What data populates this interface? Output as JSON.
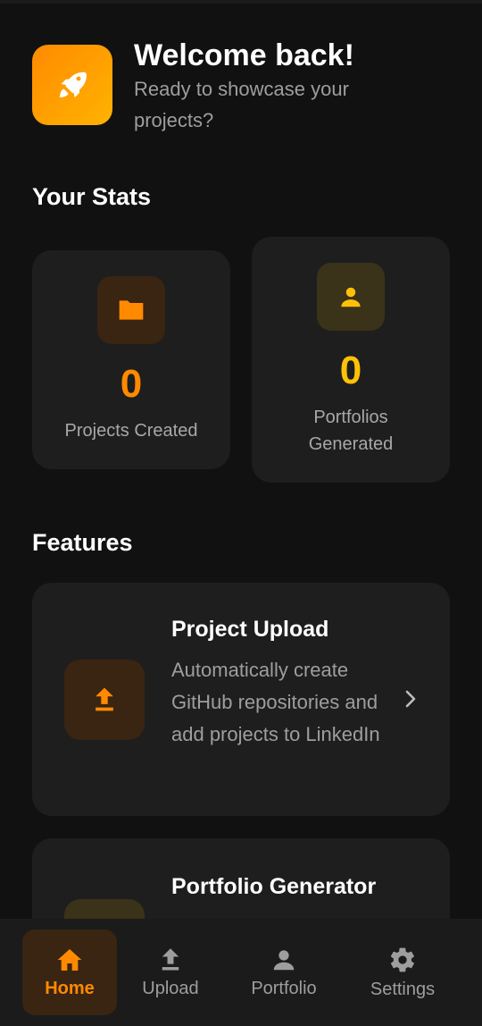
{
  "header": {
    "welcome": "Welcome back!",
    "subtitle": "Ready to showcase your projects?",
    "logo_icon": "rocket-icon"
  },
  "stats": {
    "title": "Your Stats",
    "items": [
      {
        "icon": "folder-icon",
        "value": "0",
        "label": "Projects Created",
        "color": "#ff8a00"
      },
      {
        "icon": "person-icon",
        "value": "0",
        "label": "Portfolios Generated",
        "color": "#ffc107"
      }
    ]
  },
  "features": {
    "title": "Features",
    "items": [
      {
        "icon": "upload-icon",
        "title": "Project Upload",
        "description": "Automatically create GitHub repositories and add projects to LinkedIn",
        "color": "#ff8a00"
      },
      {
        "icon": "portfolio-icon",
        "title": "Portfolio Generator",
        "description": "",
        "color": "#ffc107"
      }
    ]
  },
  "nav": {
    "items": [
      {
        "label": "Home",
        "icon": "home-icon",
        "active": true
      },
      {
        "label": "Upload",
        "icon": "upload-icon",
        "active": false
      },
      {
        "label": "Portfolio",
        "icon": "person-icon",
        "active": false
      },
      {
        "label": "Settings",
        "icon": "gear-icon",
        "active": false
      }
    ]
  },
  "colors": {
    "background": "#111111",
    "card": "#1e1e1e",
    "accent_orange": "#ff8a00",
    "accent_yellow": "#ffc107"
  }
}
